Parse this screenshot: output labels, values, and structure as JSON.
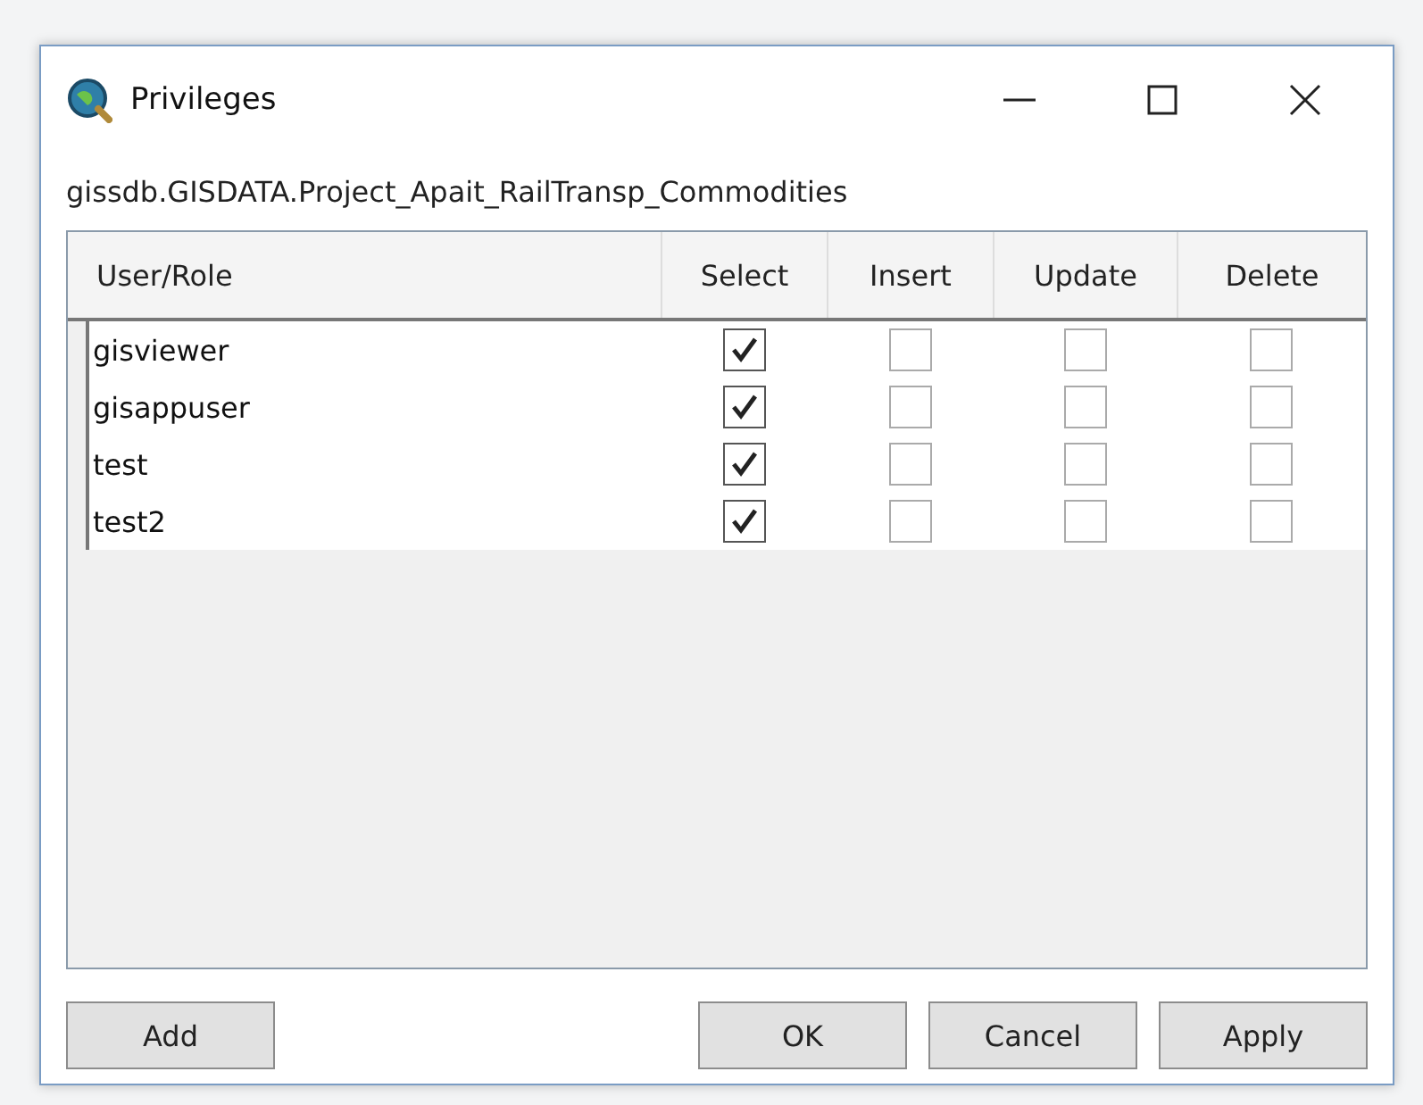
{
  "window": {
    "title": "Privileges"
  },
  "object_name": "gissdb.GISDATA.Project_Apait_RailTransp_Commodities",
  "table": {
    "columns": [
      "User/Role",
      "Select",
      "Insert",
      "Update",
      "Delete"
    ],
    "rows": [
      {
        "name": "gisviewer",
        "select": true,
        "insert": false,
        "update": false,
        "delete": false
      },
      {
        "name": "gisappuser",
        "select": true,
        "insert": false,
        "update": false,
        "delete": false
      },
      {
        "name": "test",
        "select": true,
        "insert": false,
        "update": false,
        "delete": false
      },
      {
        "name": "test2",
        "select": true,
        "insert": false,
        "update": false,
        "delete": false
      }
    ]
  },
  "buttons": {
    "left": [
      "Add"
    ],
    "right": [
      "OK",
      "Cancel",
      "Apply"
    ]
  }
}
